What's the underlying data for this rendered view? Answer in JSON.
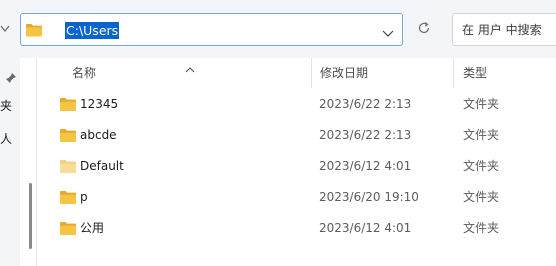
{
  "address": {
    "path": "C:\\Users"
  },
  "search": {
    "placeholder": "在 用户 中搜索"
  },
  "nav": {
    "labels": [
      "夹",
      "人"
    ]
  },
  "columns": {
    "name": "名称",
    "date": "修改日期",
    "type": "类型"
  },
  "rows": [
    {
      "name": "12345",
      "date": "2023/6/22 2:13",
      "type": "文件夹",
      "icon": "folder-icon"
    },
    {
      "name": "abcde",
      "date": "2023/6/22 2:13",
      "type": "文件夹",
      "icon": "folder-icon"
    },
    {
      "name": "Default",
      "date": "2023/6/12 4:01",
      "type": "文件夹",
      "icon": "folder-icon-faded"
    },
    {
      "name": "p",
      "date": "2023/6/20 19:10",
      "type": "文件夹",
      "icon": "folder-icon"
    },
    {
      "name": "公用",
      "date": "2023/6/12 4:01",
      "type": "文件夹",
      "icon": "folder-icon"
    }
  ],
  "colors": {
    "selection": "#0a64d0",
    "folder": "#f5c443",
    "folder_faded": "#f7dc9a"
  }
}
